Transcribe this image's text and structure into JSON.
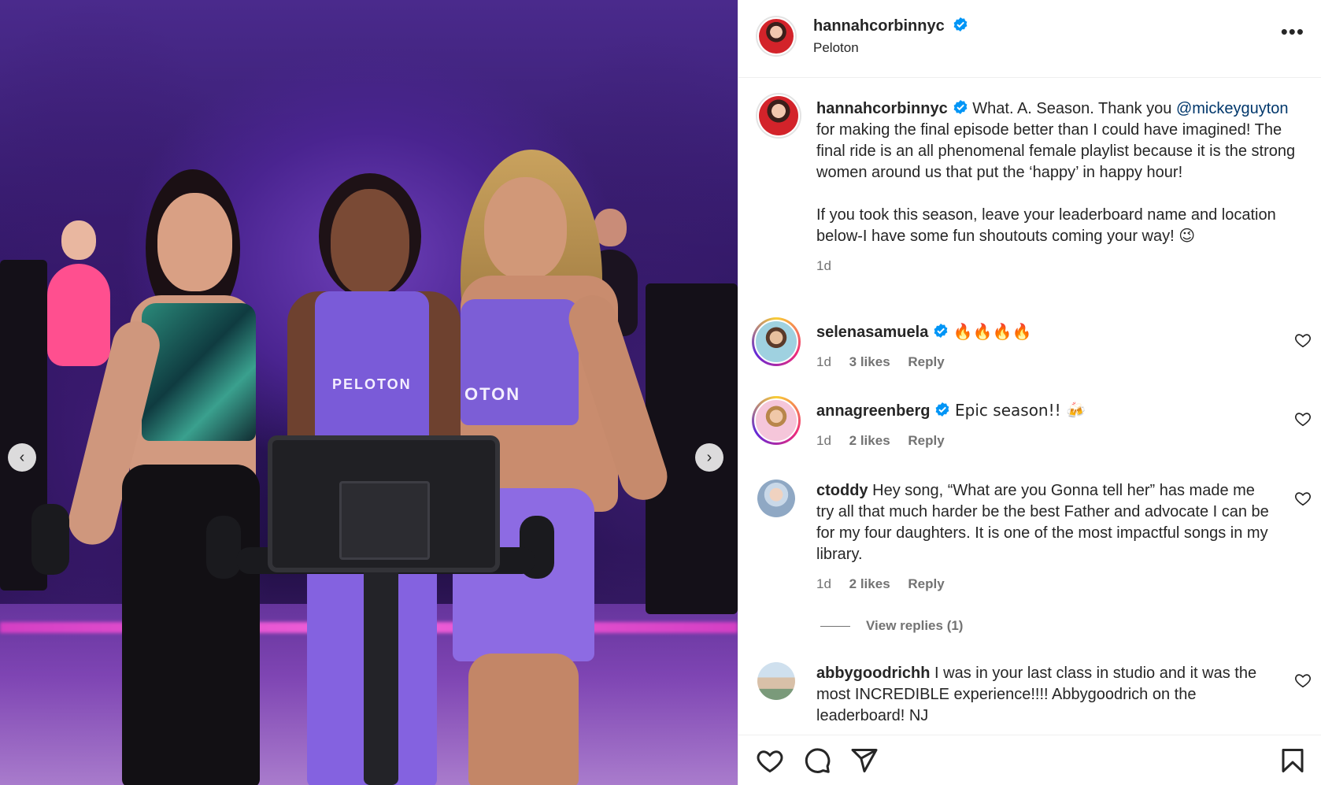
{
  "post": {
    "author": "hannahcorbinnyc",
    "location": "Peloton",
    "more_label": "•••",
    "caption": {
      "author": "hannahcorbinnyc",
      "text_before": "What. A. Season. Thank you",
      "mention": "@mickeyguyton",
      "text_after": "for making the final episode better than I could have imagined! The final ride is an all phenomenal female playlist because it is the strong women around us that put the ‘happy’ in happy hour!",
      "paragraph2": "If you took this season, leave your leaderboard name and location below-I have some fun shoutouts coming your way! 😉",
      "time": "1d"
    }
  },
  "photo": {
    "shirt_text_1": "PELOTON",
    "shirt_text_2": "OTON",
    "prev_label": "‹",
    "next_label": "›"
  },
  "comments": [
    {
      "user": "selenasamuela",
      "text": "🔥🔥🔥🔥",
      "time": "1d",
      "likes": "3 likes",
      "reply": "Reply"
    },
    {
      "user": "annagreenberg",
      "text": "Epic season!! 🍻",
      "time": "1d",
      "likes": "2 likes",
      "reply": "Reply"
    },
    {
      "user": "ctoddy",
      "text": "Hey song, “What are you Gonna tell her” has made me try all that much harder be the best Father and advocate I can be for my four daughters. It is one of the most impactful songs in my library.",
      "time": "1d",
      "likes": "2 likes",
      "reply": "Reply"
    },
    {
      "user": "abbygoodrichh",
      "text": "I was in your last class in studio and it was the most INCREDIBLE experience!!!! Abbygoodrich on the leaderboard! NJ"
    }
  ],
  "view_replies": "View replies (1)",
  "colors": {
    "verified": "#0095f6",
    "mention": "#00376b",
    "muted": "#737373"
  },
  "icons": [
    "verified-badge-icon",
    "heart-icon",
    "comment-icon",
    "share-icon",
    "bookmark-icon"
  ]
}
